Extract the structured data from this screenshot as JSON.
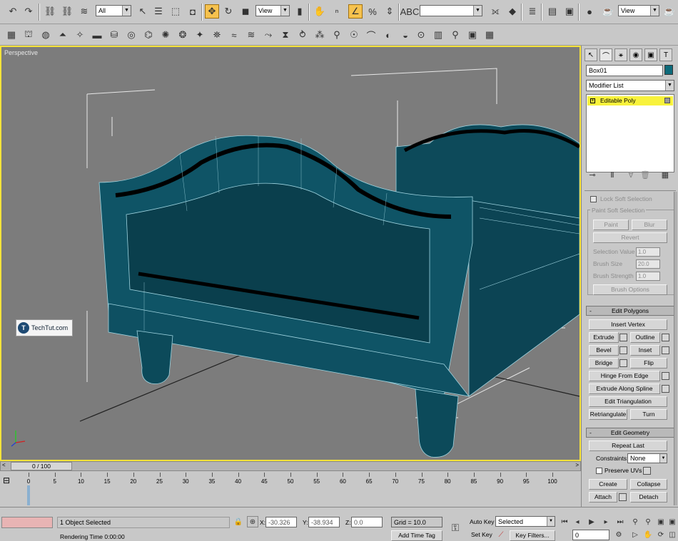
{
  "toolbar": {
    "selection_filter": "All",
    "ref_coord_1": "View",
    "named_selection": "",
    "ref_coord_2": "View"
  },
  "viewport": {
    "label": "Perspective",
    "watermark": "TechTut.com",
    "watermark_icon": "T"
  },
  "command_panel": {
    "object_name": "Box01",
    "modifier_list": "Modifier List",
    "stack_item": "Editable Poly",
    "soft_selection": {
      "lock_label": "Lock Soft Selection",
      "group_label": "Paint Soft Selection",
      "paint": "Paint",
      "blur": "Blur",
      "revert": "Revert",
      "selection_value_label": "Selection Value",
      "selection_value": "1.0",
      "brush_size_label": "Brush Size",
      "brush_size": "20.0",
      "brush_strength_label": "Brush Strength",
      "brush_strength": "1.0",
      "brush_options": "Brush Options"
    },
    "edit_polygons": {
      "title": "Edit Polygons",
      "insert_vertex": "Insert Vertex",
      "extrude": "Extrude",
      "outline": "Outline",
      "bevel": "Bevel",
      "inset": "Inset",
      "bridge": "Bridge",
      "flip": "Flip",
      "hinge_from_edge": "Hinge From Edge",
      "extrude_along_spline": "Extrude Along Spline",
      "edit_triangulation": "Edit Triangulation",
      "retriangulate": "Retriangulate",
      "turn": "Turn"
    },
    "edit_geometry": {
      "title": "Edit Geometry",
      "repeat_last": "Repeat Last",
      "constraints_label": "Constraints:",
      "constraints_value": "None",
      "preserve_uvs": "Preserve UVs",
      "create": "Create",
      "collapse": "Collapse",
      "attach": "Attach",
      "detach": "Detach"
    }
  },
  "timeline": {
    "frame_display": "0 / 100",
    "ticks": [
      "0",
      "5",
      "10",
      "15",
      "20",
      "25",
      "30",
      "35",
      "40",
      "45",
      "50",
      "55",
      "60",
      "65",
      "70",
      "75",
      "80",
      "85",
      "90",
      "95",
      "100"
    ]
  },
  "status": {
    "selection": "1 Object Selected",
    "rendering": "Rendering Time  0:00:00",
    "x_label": "X:",
    "x_value": "-30.326",
    "y_label": "Y:",
    "y_value": "-38.934",
    "z_label": "Z:",
    "z_value": "0.0",
    "grid": "Grid = 10.0",
    "add_time_tag": "Add Time Tag",
    "auto_key": "Auto Key",
    "set_key": "Set Key",
    "key_mode": "Selected",
    "key_filters": "Key Filters...",
    "current_frame": "0"
  },
  "colors": {
    "viewport_bg": "#7c7c7c",
    "mesh": "#0d4a5a",
    "active_border": "#f6e33a",
    "stack_highlight": "#f8f23c"
  }
}
